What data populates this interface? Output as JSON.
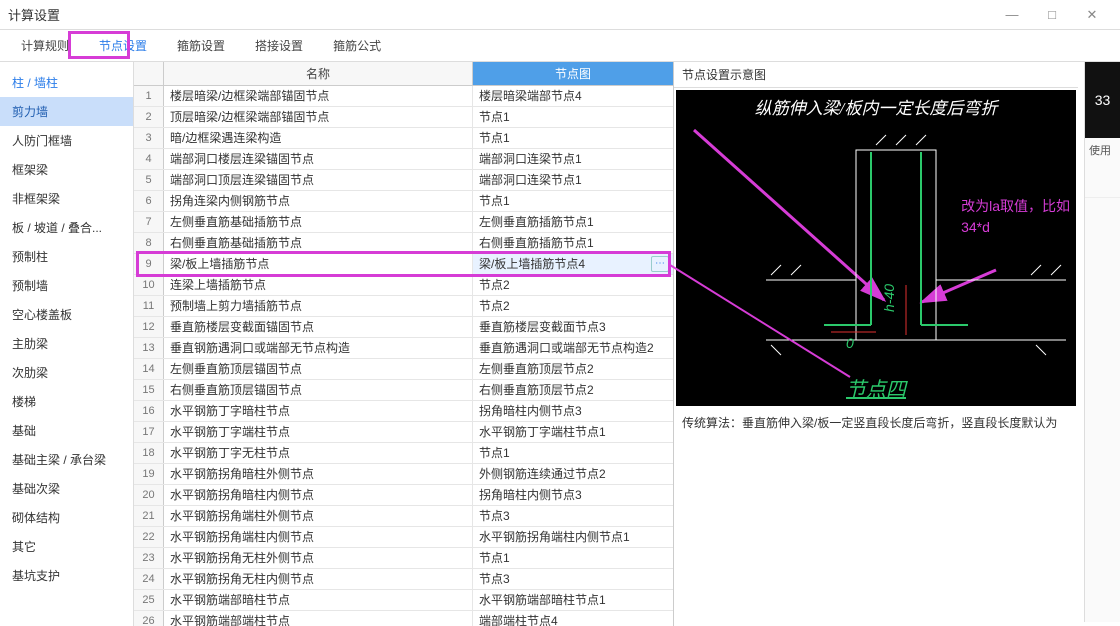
{
  "window": {
    "title": "计算设置"
  },
  "tabs": [
    "计算规则",
    "节点设置",
    "箍筋设置",
    "搭接设置",
    "箍筋公式"
  ],
  "active_tab": 1,
  "sidebar": {
    "items": [
      "柱 / 墙柱",
      "剪力墙",
      "人防门框墙",
      "框架梁",
      "非框架梁",
      "板 / 坡道 / 叠合...",
      "预制柱",
      "预制墙",
      "空心楼盖板",
      "主肋梁",
      "次肋梁",
      "楼梯",
      "基础",
      "基础主梁 / 承台梁",
      "基础次梁",
      "砌体结构",
      "其它",
      "基坑支护"
    ],
    "active": 1
  },
  "table": {
    "headers": {
      "name": "名称",
      "img": "节点图"
    },
    "selected_row": 9,
    "rows": [
      {
        "n": 1,
        "name": "楼层暗梁/边框梁端部锚固节点",
        "img": "楼层暗梁端部节点4"
      },
      {
        "n": 2,
        "name": "顶层暗梁/边框梁端部锚固节点",
        "img": "节点1"
      },
      {
        "n": 3,
        "name": "暗/边框梁遇连梁构造",
        "img": "节点1"
      },
      {
        "n": 4,
        "name": "端部洞口楼层连梁锚固节点",
        "img": "端部洞口连梁节点1"
      },
      {
        "n": 5,
        "name": "端部洞口顶层连梁锚固节点",
        "img": "端部洞口连梁节点1"
      },
      {
        "n": 6,
        "name": "拐角连梁内侧钢筋节点",
        "img": "节点1"
      },
      {
        "n": 7,
        "name": "左侧垂直筋基础插筋节点",
        "img": "左侧垂直筋插筋节点1"
      },
      {
        "n": 8,
        "name": "右侧垂直筋基础插筋节点",
        "img": "右侧垂直筋插筋节点1"
      },
      {
        "n": 9,
        "name": "梁/板上墙插筋节点",
        "img": "梁/板上墙插筋节点4"
      },
      {
        "n": 10,
        "name": "连梁上墙插筋节点",
        "img": "节点2"
      },
      {
        "n": 11,
        "name": "预制墙上剪力墙插筋节点",
        "img": "节点2"
      },
      {
        "n": 12,
        "name": "垂直筋楼层变截面锚固节点",
        "img": "垂直筋楼层变截面节点3"
      },
      {
        "n": 13,
        "name": "垂直钢筋遇洞口或端部无节点构造",
        "img": "垂直筋遇洞口或端部无节点构造2"
      },
      {
        "n": 14,
        "name": "左侧垂直筋顶层锚固节点",
        "img": "左侧垂直筋顶层节点2"
      },
      {
        "n": 15,
        "name": "右侧垂直筋顶层锚固节点",
        "img": "右侧垂直筋顶层节点2"
      },
      {
        "n": 16,
        "name": "水平钢筋丁字暗柱节点",
        "img": "拐角暗柱内侧节点3"
      },
      {
        "n": 17,
        "name": "水平钢筋丁字端柱节点",
        "img": "水平钢筋丁字端柱节点1"
      },
      {
        "n": 18,
        "name": "水平钢筋丁字无柱节点",
        "img": "节点1"
      },
      {
        "n": 19,
        "name": "水平钢筋拐角暗柱外侧节点",
        "img": "外侧钢筋连续通过节点2"
      },
      {
        "n": 20,
        "name": "水平钢筋拐角暗柱内侧节点",
        "img": "拐角暗柱内侧节点3"
      },
      {
        "n": 21,
        "name": "水平钢筋拐角端柱外侧节点",
        "img": "节点3"
      },
      {
        "n": 22,
        "name": "水平钢筋拐角端柱内侧节点",
        "img": "水平钢筋拐角端柱内侧节点1"
      },
      {
        "n": 23,
        "name": "水平钢筋拐角无柱外侧节点",
        "img": "节点1"
      },
      {
        "n": 24,
        "name": "水平钢筋拐角无柱内侧节点",
        "img": "节点3"
      },
      {
        "n": 25,
        "name": "水平钢筋端部暗柱节点",
        "img": "水平钢筋端部暗柱节点1"
      },
      {
        "n": 26,
        "name": "水平钢筋端部端柱节点",
        "img": "端部端柱节点4"
      }
    ]
  },
  "preview": {
    "title": "节点设置示意图",
    "diagram_title": "纵筋伸入梁/板内一定长度后弯折",
    "diagram_foot": "节点四",
    "note_line1": "改为la取值，比如",
    "note_line2": "34*d",
    "dim_zero": "0",
    "dim_h": "h-40",
    "caption": "传统算法：垂直筋伸入梁/板一定竖直段长度后弯折，竖直段长度默认为"
  },
  "rightedge": {
    "badge": "33",
    "label": "使用"
  }
}
